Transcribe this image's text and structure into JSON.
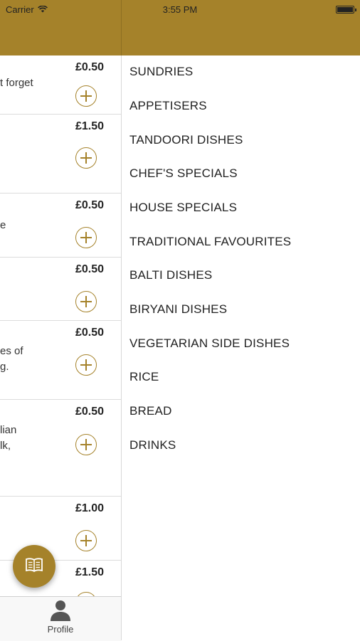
{
  "status_bar": {
    "carrier": "Carrier",
    "time": "3:55 PM"
  },
  "colors": {
    "accent": "#a5822a"
  },
  "menu_items": [
    {
      "price": "£0.50",
      "desc": "t forget"
    },
    {
      "price": "£1.50",
      "desc": ""
    },
    {
      "price": "£0.50",
      "desc": "e"
    },
    {
      "price": "£0.50",
      "desc": ""
    },
    {
      "price": "£0.50",
      "desc": "es of\ng."
    },
    {
      "price": "£0.50",
      "desc": "lian\nlk,"
    },
    {
      "price": "£1.00",
      "desc": ""
    },
    {
      "price": "£1.50",
      "desc": ""
    }
  ],
  "tabbar": {
    "profile_label": "Profile"
  },
  "categories": [
    "SUNDRIES",
    "APPETISERS",
    "TANDOORI DISHES",
    "CHEF'S SPECIALS",
    "HOUSE SPECIALS",
    "TRADITIONAL FAVOURITES",
    "BALTI DISHES",
    "BIRYANI DISHES",
    "VEGETARIAN SIDE DISHES",
    "RICE",
    "BREAD",
    "DRINKS"
  ]
}
